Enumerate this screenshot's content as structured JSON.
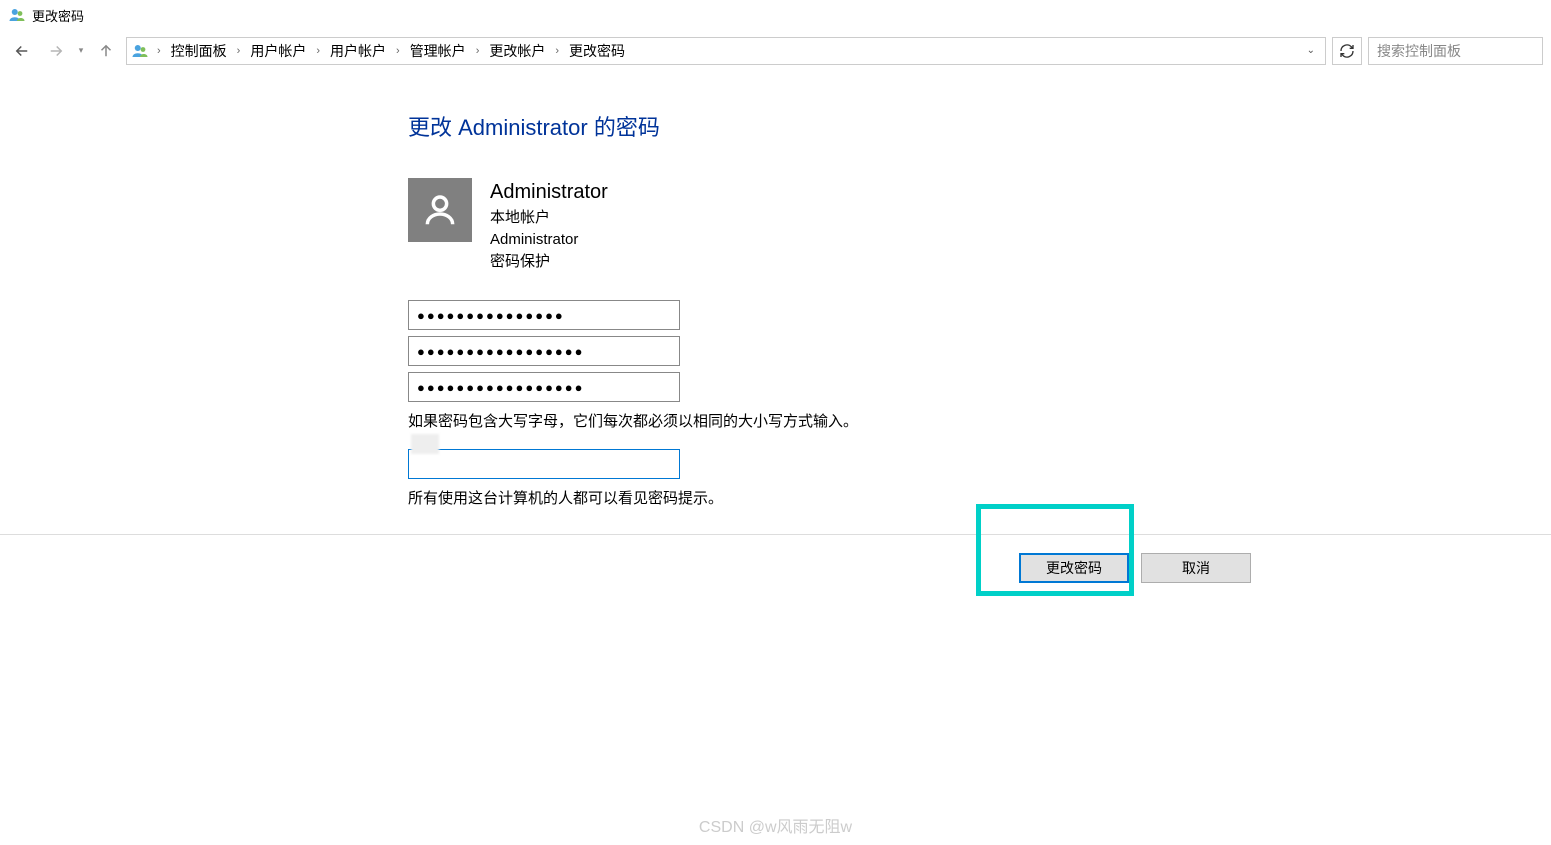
{
  "window": {
    "title": "更改密码"
  },
  "breadcrumb": {
    "items": [
      "控制面板",
      "用户帐户",
      "用户帐户",
      "管理帐户",
      "更改帐户",
      "更改密码"
    ]
  },
  "search": {
    "placeholder": "搜索控制面板"
  },
  "page": {
    "heading": "更改 Administrator 的密码",
    "user": {
      "name": "Administrator",
      "account_type": "本地帐户",
      "role": "Administrator",
      "pw_status": "密码保护"
    },
    "password_fields": {
      "current": "●●●●●●●●●●●●●●●",
      "new": "●●●●●●●●●●●●●●●●●",
      "confirm": "●●●●●●●●●●●●●●●●●"
    },
    "caps_note": "如果密码包含大写字母，它们每次都必须以相同的大小写方式输入。",
    "hint_value": "",
    "hint_note": "所有使用这台计算机的人都可以看见密码提示。"
  },
  "buttons": {
    "change": "更改密码",
    "cancel": "取消"
  },
  "watermark": "CSDN @w风雨无阻w"
}
